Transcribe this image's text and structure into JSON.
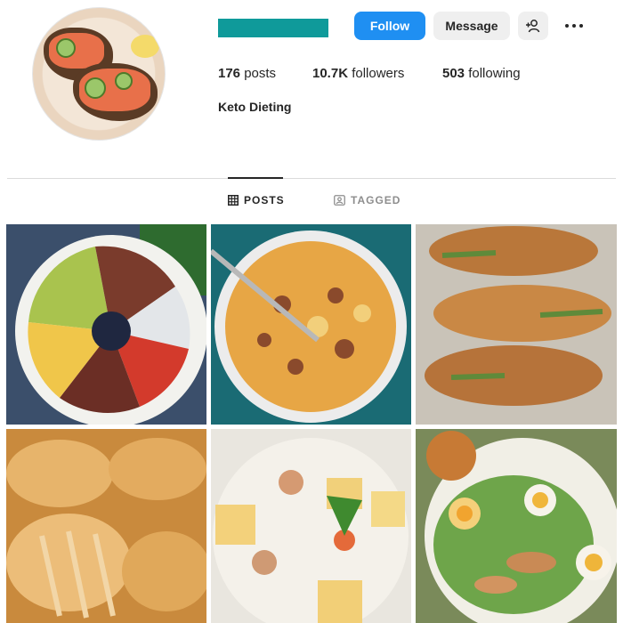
{
  "profile": {
    "username_redacted": true,
    "full_name": "Keto Dieting",
    "avatar_icon": "food-avatar"
  },
  "actions": {
    "follow_label": "Follow",
    "message_label": "Message",
    "add_user_icon": "add-user-icon",
    "more_icon": "more-options-icon"
  },
  "stats": {
    "posts_count": "176",
    "posts_label": "posts",
    "followers_count": "10.7K",
    "followers_label": "followers",
    "following_count": "503",
    "following_label": "following"
  },
  "tabs": [
    {
      "label": "POSTS",
      "icon": "grid-icon",
      "active": true
    },
    {
      "label": "TAGGED",
      "icon": "tag-icon",
      "active": false
    }
  ],
  "colors": {
    "accent": "#1f8ff2",
    "username_bar": "#0f9a9a"
  }
}
